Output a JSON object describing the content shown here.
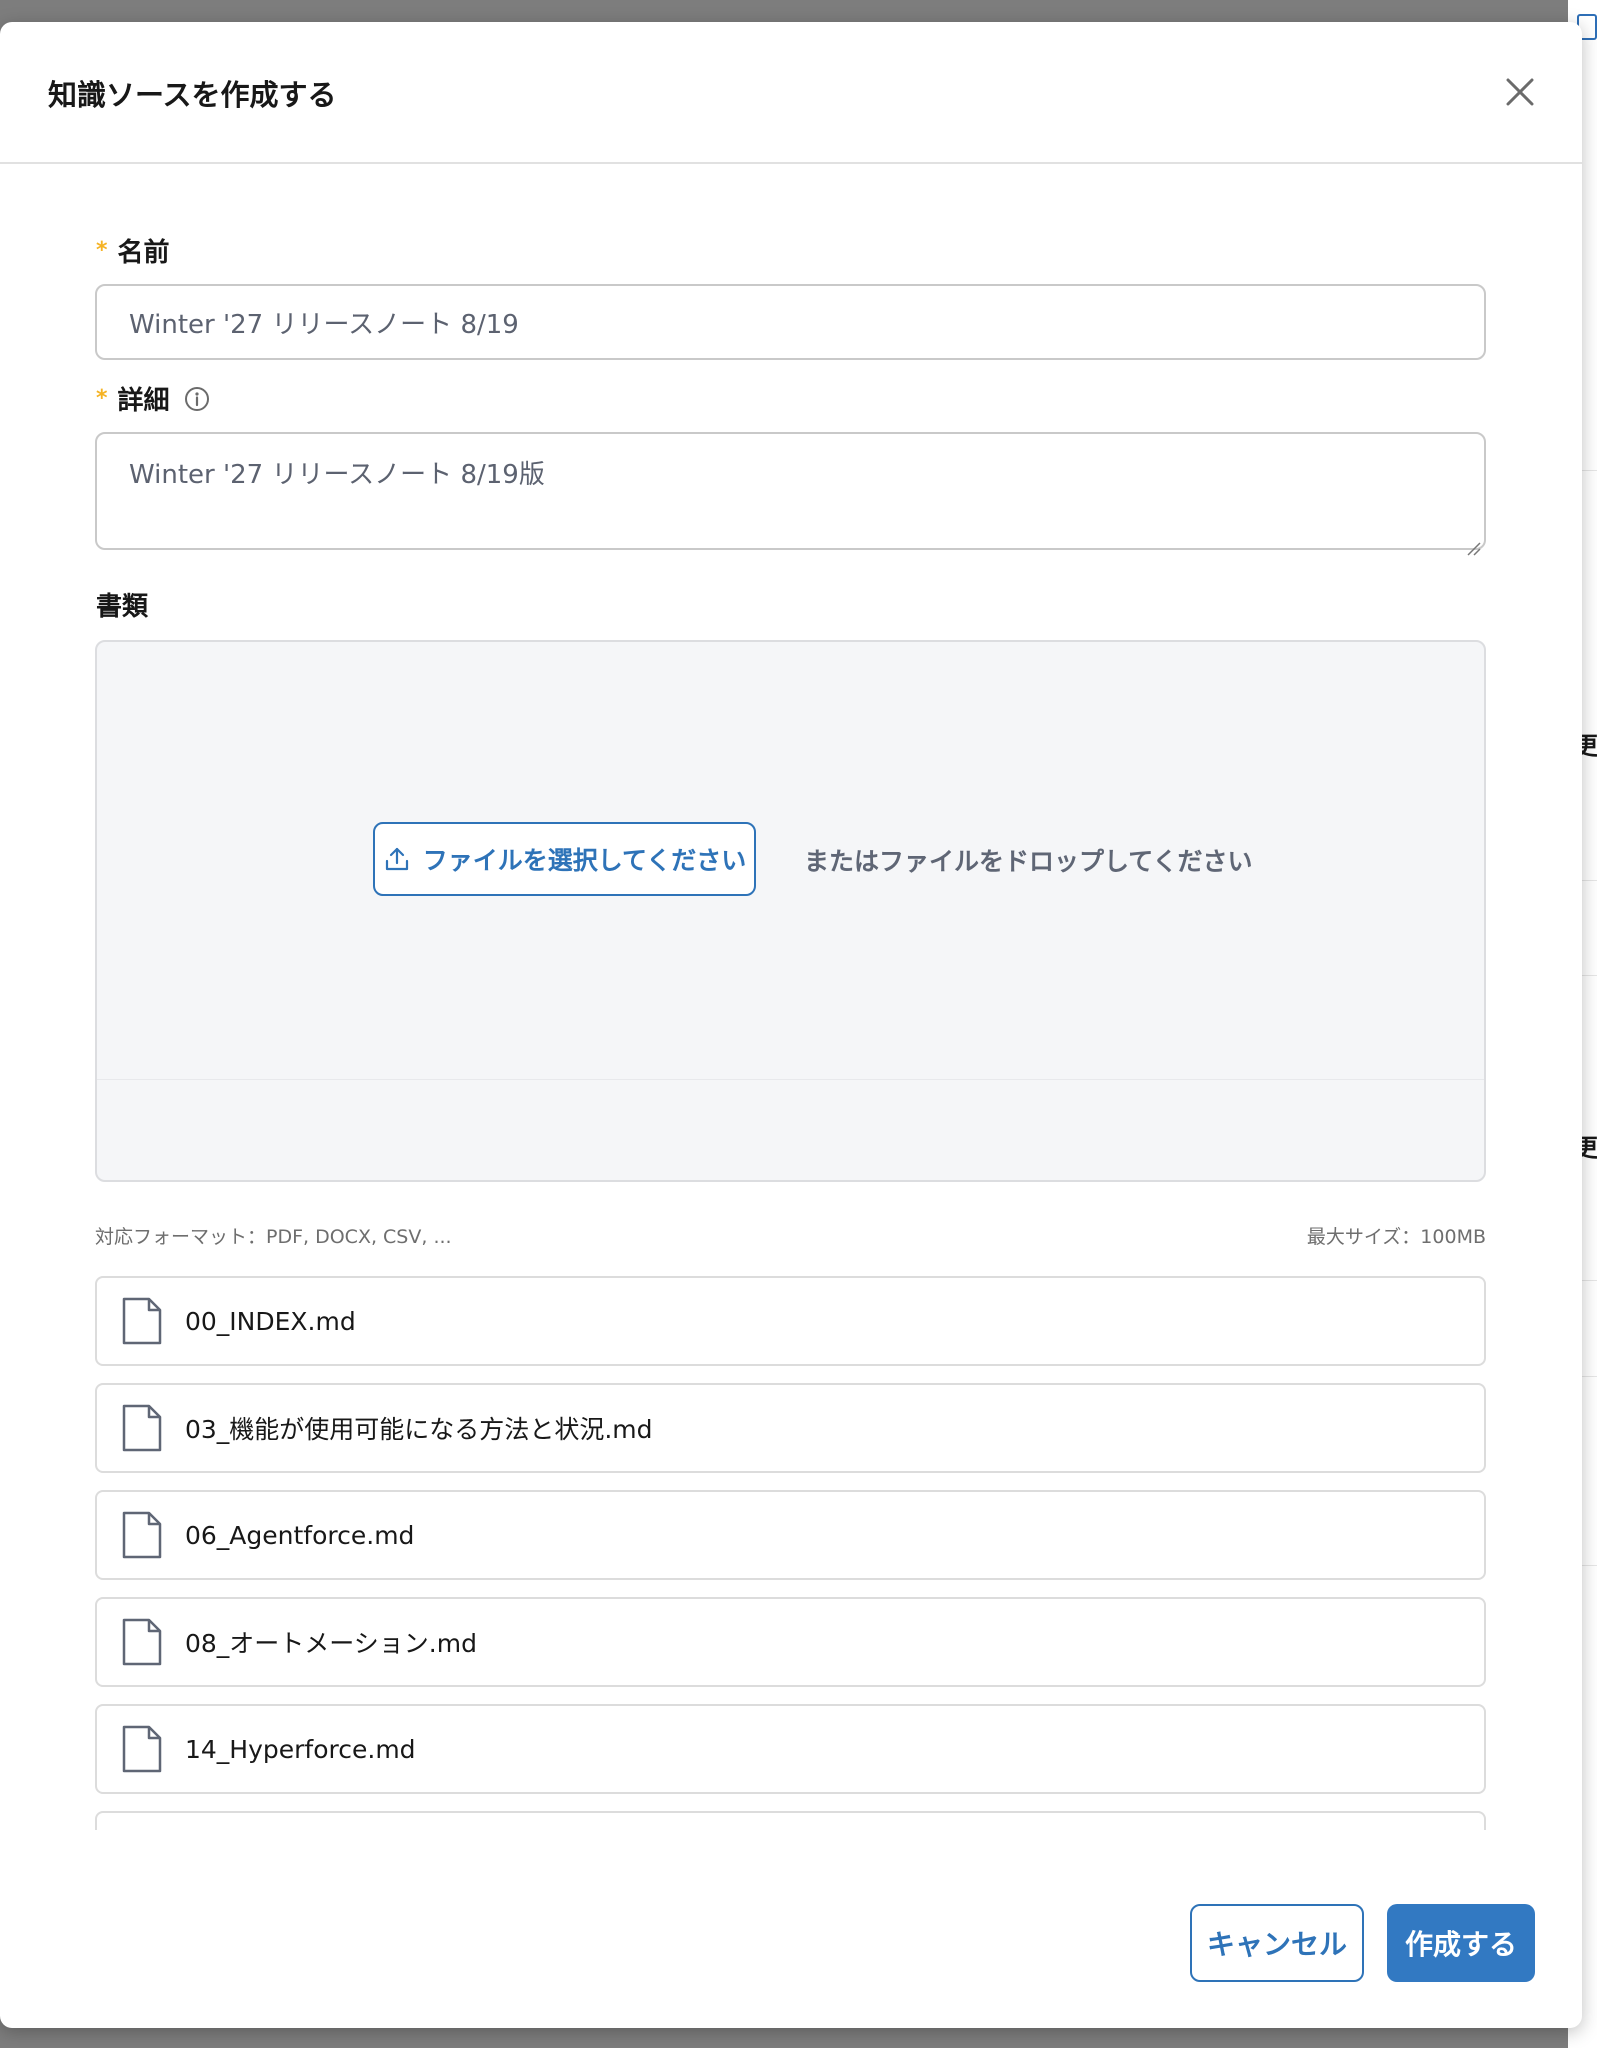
{
  "background": {
    "fragments": [
      "更新",
      "更新"
    ]
  },
  "modal": {
    "title": "知識ソースを作成する",
    "close_icon": "close-icon"
  },
  "form": {
    "name": {
      "label": "名前",
      "required_mark": "*",
      "value": "Winter '27 リリースノート 8/19"
    },
    "details": {
      "label": "詳細",
      "required_mark": "*",
      "info_icon": "info-icon",
      "value": "Winter '27 リリースノート 8/19版"
    },
    "documents": {
      "label": "書類",
      "upload_button_label": "ファイルを選択してください",
      "upload_icon": "upload-icon",
      "drop_text": "またはファイルをドロップしてください",
      "supported_formats": "対応フォーマット：PDF, DOCX, CSV, ...",
      "max_size": "最大サイズ：100MB"
    }
  },
  "files": [
    {
      "name": "00_INDEX.md",
      "icon": "file-icon"
    },
    {
      "name": "03_機能が使用可能になる方法と状況.md",
      "icon": "file-icon"
    },
    {
      "name": "06_Agentforce.md",
      "icon": "file-icon"
    },
    {
      "name": "08_オートメーション.md",
      "icon": "file-icon"
    },
    {
      "name": "14_Hyperforce.md",
      "icon": "file-icon"
    },
    {
      "name": "",
      "icon": "file-icon"
    }
  ],
  "footer": {
    "cancel_label": "キャンセル",
    "create_label": "作成する"
  },
  "colors": {
    "accent": "#2e73b8",
    "primary_button": "#3279c2",
    "required": "#f5b324",
    "overlay": "#7d7d7d"
  }
}
